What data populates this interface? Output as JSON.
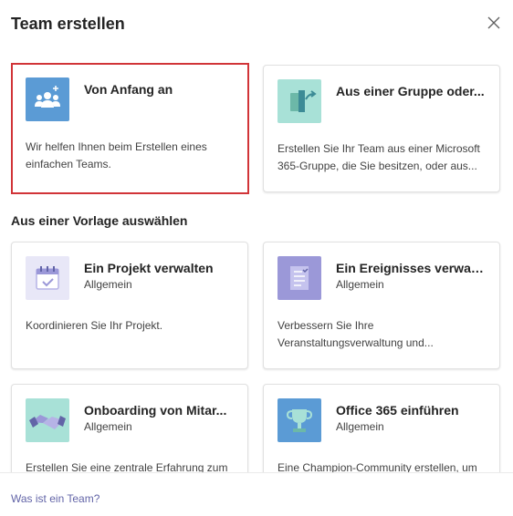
{
  "dialog": {
    "title": "Team erstellen",
    "close_icon": "close-icon"
  },
  "top_cards": [
    {
      "title": "Von Anfang an",
      "description": "Wir helfen Ihnen beim Erstellen eines einfachen Teams.",
      "icon": "team-people-icon",
      "icon_color": "#5b9bd5",
      "selected": true
    },
    {
      "title": "Aus einer Gruppe oder...",
      "description": "Erstellen Sie Ihr Team aus einer Microsoft 365-Gruppe, die Sie besitzen, oder aus...",
      "icon": "group-share-icon",
      "icon_color": "#a8e1d7",
      "selected": false
    }
  ],
  "templates_section": {
    "label": "Aus einer Vorlage auswählen"
  },
  "template_cards": [
    {
      "title": "Ein Projekt verwalten",
      "category": "Allgemein",
      "description": "Koordinieren Sie Ihr Projekt.",
      "icon": "calendar-check-icon",
      "icon_color": "#e8e7f7"
    },
    {
      "title": "Ein Ereignisses verwalt...",
      "category": "Allgemein",
      "description": "Verbessern Sie Ihre Veranstaltungsverwaltung und...",
      "icon": "checklist-icon",
      "icon_color": "#9b98d8"
    },
    {
      "title": "Onboarding von Mitar...",
      "category": "Allgemein",
      "description": "Erstellen Sie eine zentrale Erfahrung zum",
      "icon": "handshake-icon",
      "icon_color": "#a8e1d7"
    },
    {
      "title": "Office 365 einführen",
      "category": "Allgemein",
      "description": "Eine Champion-Community erstellen, um",
      "icon": "trophy-icon",
      "icon_color": "#5b9bd5"
    }
  ],
  "footer": {
    "link": "Was ist ein Team?"
  }
}
